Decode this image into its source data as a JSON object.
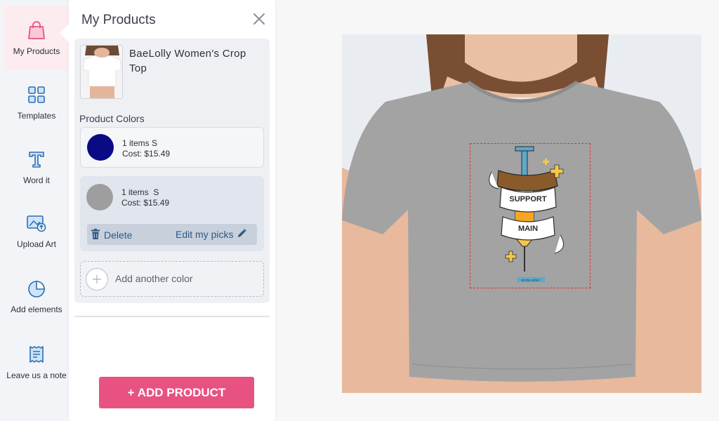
{
  "sidebar": {
    "items": [
      {
        "label": "My Products",
        "icon": "shopping-bag-icon",
        "active": true
      },
      {
        "label": "Templates",
        "icon": "templates-grid-icon",
        "active": false
      },
      {
        "label": "Word it",
        "icon": "text-t-icon",
        "active": false
      },
      {
        "label": "Upload Art",
        "icon": "upload-image-icon",
        "active": false
      },
      {
        "label": "Add elements",
        "icon": "shape-elements-icon",
        "active": false
      },
      {
        "label": "Leave us a note",
        "icon": "note-icon",
        "active": false
      }
    ]
  },
  "panel": {
    "title": "My Products",
    "product": {
      "name": "BaeLolly Women's Crop Top"
    },
    "colors_heading": "Product Colors",
    "colors": [
      {
        "hex": "#0a0a87",
        "line1": "1 items S",
        "line2": "Cost: $15.49"
      },
      {
        "hex": "#9e9e9e",
        "line1": "1 items  S",
        "line2": "Cost: $15.49",
        "selected": true
      }
    ],
    "actions": {
      "delete_label": "Delete",
      "edit_label": "Edit my picks"
    },
    "add_color_label": "Add another color",
    "add_product_label": "+ ADD PRODUCT"
  },
  "preview": {
    "design_text": [
      "SUPPORT",
      "MAIN"
    ],
    "tag_text": "BYOS ARMY",
    "shirt_color": "#a3a3a3",
    "accent_color": "#e85281"
  }
}
